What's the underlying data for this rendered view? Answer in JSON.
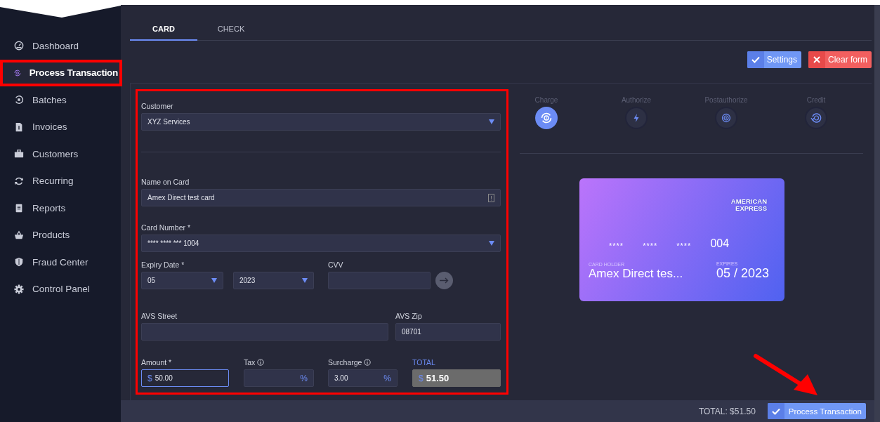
{
  "sidebar": {
    "items": [
      {
        "label": "Dashboard",
        "selected": false,
        "highlighted": false
      },
      {
        "label": "Process Transaction",
        "selected": true,
        "highlighted": true
      },
      {
        "label": "Batches",
        "selected": false,
        "highlighted": false
      },
      {
        "label": "Invoices",
        "selected": false,
        "highlighted": false
      },
      {
        "label": "Customers",
        "selected": false,
        "highlighted": false
      },
      {
        "label": "Recurring",
        "selected": false,
        "highlighted": false
      },
      {
        "label": "Reports",
        "selected": false,
        "highlighted": false
      },
      {
        "label": "Products",
        "selected": false,
        "highlighted": false
      },
      {
        "label": "Fraud Center",
        "selected": false,
        "highlighted": false
      },
      {
        "label": "Control Panel",
        "selected": false,
        "highlighted": false
      }
    ]
  },
  "tabs": [
    {
      "label": "CARD",
      "selected": true
    },
    {
      "label": "CHECK",
      "selected": false
    }
  ],
  "actions": [
    {
      "label": "Settings",
      "kind": "primary"
    },
    {
      "label": "Clear form",
      "kind": "danger"
    }
  ],
  "form": {
    "highlighted": true,
    "customer": {
      "label": "Customer",
      "value": "XYZ Services"
    },
    "name_on_card": {
      "label": "Name on Card",
      "value": "Amex Direct test card"
    },
    "card_number": {
      "label": "Card Number *",
      "value": "**** **** *** 1004"
    },
    "expiry": {
      "label": "Expiry Date *",
      "month": "05",
      "year": "2023"
    },
    "cvv": {
      "label": "CVV"
    },
    "avs_street": {
      "label": "AVS Street"
    },
    "avs_zip": {
      "label": "AVS Zip",
      "value": "08701"
    },
    "amount": {
      "label": "Amount *",
      "currency": "$",
      "value": "50.00",
      "focused": true
    },
    "tax": {
      "label": "Tax",
      "unit": "%"
    },
    "surcharge": {
      "label": "Surcharge",
      "value": "3.00",
      "unit": "%"
    },
    "total": {
      "label": "TOTAL",
      "currency": "$",
      "value": "51.50"
    }
  },
  "transaction_types": [
    {
      "label": "Charge",
      "selected": true
    },
    {
      "label": "Authorize",
      "selected": false
    },
    {
      "label": "Postauthorize",
      "selected": false
    },
    {
      "label": "Credit",
      "selected": false
    }
  ],
  "card_preview": {
    "brand": "AMERICAN EXPRESS",
    "number_groups": [
      "****",
      "****",
      "****",
      "004"
    ],
    "holder_label": "CARD HOLDER",
    "holder": "Amex Direct tes...",
    "expires_label": "EXPIRES",
    "expires": "05 / 2023"
  },
  "footer": {
    "total": "TOTAL: $51.50",
    "button": "Process Transaction",
    "arrow_annotation": true
  }
}
